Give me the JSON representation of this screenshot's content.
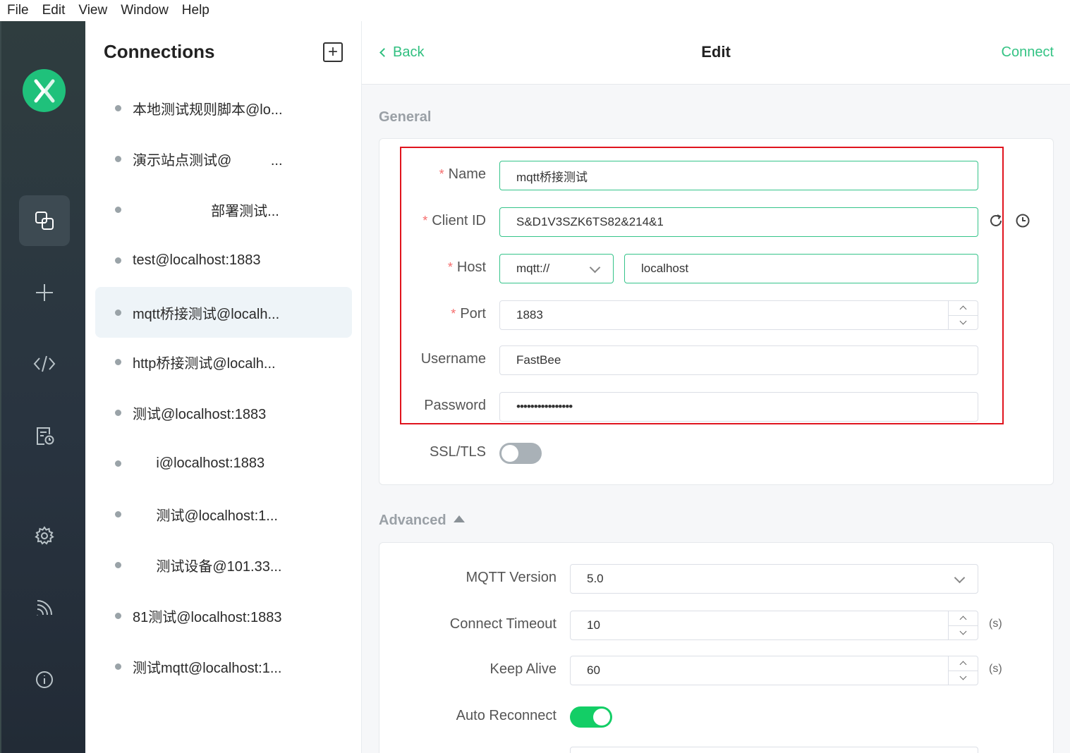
{
  "menu": [
    "File",
    "Edit",
    "View",
    "Window",
    "Help"
  ],
  "sidebar": {
    "items": [
      {
        "icon": "connections-icon",
        "active": true
      },
      {
        "icon": "plus-icon",
        "active": false
      },
      {
        "icon": "code-icon",
        "active": false
      },
      {
        "icon": "log-icon",
        "active": false
      },
      {
        "icon": "settings-icon",
        "active": false
      },
      {
        "icon": "feed-icon",
        "active": false
      },
      {
        "icon": "info-icon",
        "active": false
      }
    ]
  },
  "connections": {
    "title": "Connections",
    "add_label": "+",
    "items": [
      {
        "name": "本地测试规则脚本@lo..."
      },
      {
        "name": "演示站点测试@          ..."
      },
      {
        "name": "                    部署测试..."
      },
      {
        "name": "test@localhost:1883"
      },
      {
        "name": "mqtt桥接测试@localh...",
        "selected": true
      },
      {
        "name": "http桥接测试@localh..."
      },
      {
        "name": "测试@localhost:1883"
      },
      {
        "name": "      i@localhost:1883"
      },
      {
        "name": "      测试@localhost:1..."
      },
      {
        "name": "      测试设备@101.33..."
      },
      {
        "name": "81测试@localhost:1883"
      },
      {
        "name": "测试mqtt@localhost:1..."
      }
    ]
  },
  "header": {
    "back_label": "Back",
    "title": "Edit",
    "connect_label": "Connect"
  },
  "general": {
    "section_title": "General",
    "name_label": "Name",
    "name_value": "mqtt桥接测试",
    "client_id_label": "Client ID",
    "client_id_value": "S&D1V3SZK6TS82&214&1",
    "host_label": "Host",
    "protocol_value": "mqtt://",
    "host_value": "localhost",
    "port_label": "Port",
    "port_value": "1883",
    "username_label": "Username",
    "username_value": "FastBee",
    "password_label": "Password",
    "password_value": "••••••••••••••••",
    "ssl_label": "SSL/TLS",
    "ssl_enabled": false,
    "required_mark": "*"
  },
  "advanced": {
    "section_title": "Advanced",
    "mqtt_version_label": "MQTT Version",
    "mqtt_version_value": "5.0",
    "connect_timeout_label": "Connect Timeout",
    "connect_timeout_value": "10",
    "keep_alive_label": "Keep Alive",
    "keep_alive_value": "60",
    "unit_seconds": "(s)",
    "auto_reconnect_label": "Auto Reconnect",
    "auto_reconnect_enabled": true
  },
  "colors": {
    "accent": "#34c384",
    "rail_bg": "#2b3640",
    "highlight": "#e0141e",
    "toggle_on": "#13ce66"
  }
}
